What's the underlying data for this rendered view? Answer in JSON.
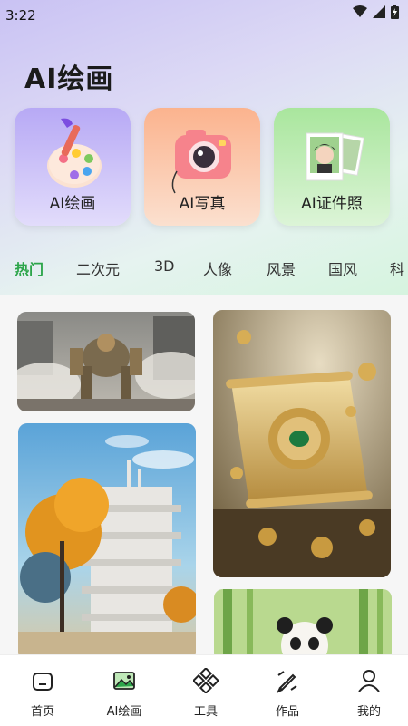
{
  "status": {
    "time": "3:22"
  },
  "header": {
    "title": "AI绘画"
  },
  "features": [
    {
      "label": "AI绘画",
      "icon": "palette-icon"
    },
    {
      "label": "AI写真",
      "icon": "camera-icon"
    },
    {
      "label": "AI证件照",
      "icon": "id-photo-icon"
    }
  ],
  "categories": [
    "热门",
    "二次元",
    "3D",
    "人像",
    "风景",
    "国风",
    "科"
  ],
  "active_category": "热门",
  "tabbar": [
    {
      "label": "首页",
      "icon": "home-icon"
    },
    {
      "label": "AI绘画",
      "icon": "image-icon"
    },
    {
      "label": "工具",
      "icon": "tools-icon"
    },
    {
      "label": "作品",
      "icon": "pen-icon"
    },
    {
      "label": "我的",
      "icon": "user-icon"
    }
  ],
  "colors": {
    "accent": "#2ca54a"
  }
}
